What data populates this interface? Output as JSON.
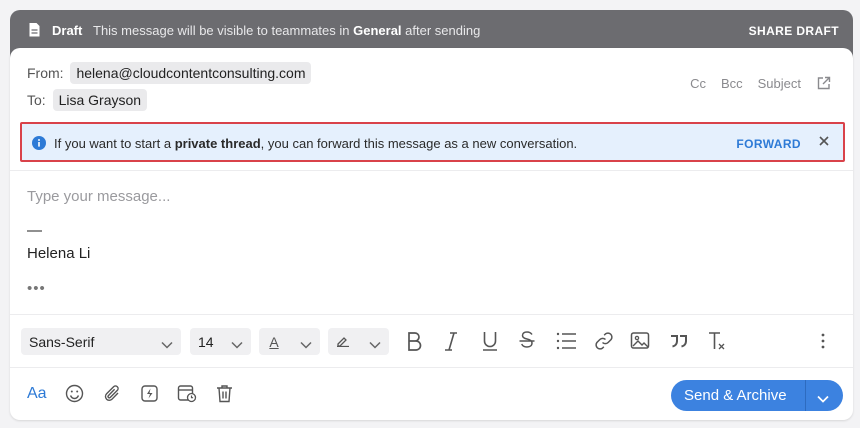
{
  "draft_bar": {
    "label": "Draft",
    "message_pre": "This message will be visible to teammates in",
    "team": "General",
    "message_post": "after sending",
    "share": "SHARE DRAFT"
  },
  "header": {
    "from_label": "From:",
    "from_value": "helena@cloudcontentconsulting.com",
    "to_label": "To:",
    "to_value": "Lisa Grayson",
    "cc": "Cc",
    "bcc": "Bcc",
    "subject": "Subject"
  },
  "banner": {
    "text_pre": "If you want to start a",
    "text_bold": "private thread",
    "text_post": ", you can forward this message as a new conversation.",
    "forward": "FORWARD"
  },
  "body": {
    "placeholder": "Type your message...",
    "sig_dash": "—",
    "sig_name": "Helena Li",
    "ellipsis": "•••"
  },
  "toolbar": {
    "font_family": "Sans-Serif",
    "font_size": "14",
    "text_color_glyph": "A"
  },
  "footer": {
    "aa": "Aa",
    "send_label": "Send & Archive"
  },
  "colors": {
    "accent": "#3c82e0",
    "banner_bg": "#e5f0fd",
    "banner_border": "#d9424a",
    "draft_bar": "#6c6c70"
  }
}
